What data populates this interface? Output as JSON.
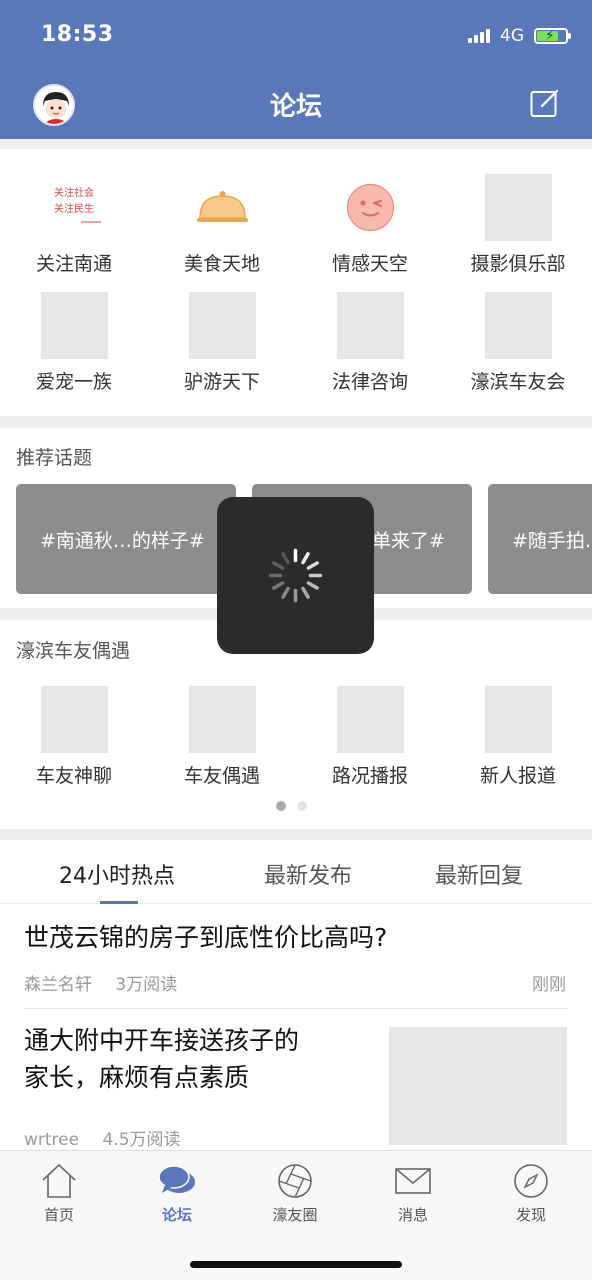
{
  "status_bar": {
    "time": "18:53",
    "network": "4G"
  },
  "header": {
    "title": "论坛"
  },
  "forum_categories": [
    {
      "label": "关注南通",
      "icon": "calligraphy-logo-icon"
    },
    {
      "label": "美食天地",
      "icon": "food-cloche-icon"
    },
    {
      "label": "情感天空",
      "icon": "wink-face-icon"
    },
    {
      "label": "摄影俱乐部",
      "icon": "placeholder-image"
    },
    {
      "label": "爱宠一族",
      "icon": "placeholder-image"
    },
    {
      "label": "驴游天下",
      "icon": "placeholder-image"
    },
    {
      "label": "法律咨询",
      "icon": "placeholder-image"
    },
    {
      "label": "濠滨车友会",
      "icon": "placeholder-image"
    }
  ],
  "recommended_topics": {
    "title": "推荐话题",
    "items": [
      "#南通秋…的样子#",
      "单来了#",
      "#随手拍…"
    ]
  },
  "car_club": {
    "title": "濠滨车友偶遇",
    "items": [
      {
        "label": "车友神聊"
      },
      {
        "label": "车友偶遇"
      },
      {
        "label": "路况播报"
      },
      {
        "label": "新人报道"
      }
    ]
  },
  "feed_tabs": [
    "24小时热点",
    "最新发布",
    "最新回复"
  ],
  "posts": [
    {
      "title": "世茂云锦的房子到底性价比高吗?",
      "author": "森兰名轩",
      "reads": "3万阅读",
      "time": "刚刚"
    },
    {
      "title_line1": "通大附中开车接送孩子的",
      "title_line2": "家长，麻烦有点素质",
      "author": "wrtree",
      "reads": "4.5万阅读"
    }
  ],
  "tab_bar": [
    {
      "label": "首页",
      "icon": "home-icon"
    },
    {
      "label": "论坛",
      "icon": "chat-bubble-icon"
    },
    {
      "label": "濠友圈",
      "icon": "aperture-icon"
    },
    {
      "label": "消息",
      "icon": "mail-icon"
    },
    {
      "label": "发现",
      "icon": "compass-icon"
    }
  ],
  "colors": {
    "brand": "#5a77b9",
    "topic_bg": "#8c8c8c",
    "loading_bg": "#2b2b2b"
  }
}
